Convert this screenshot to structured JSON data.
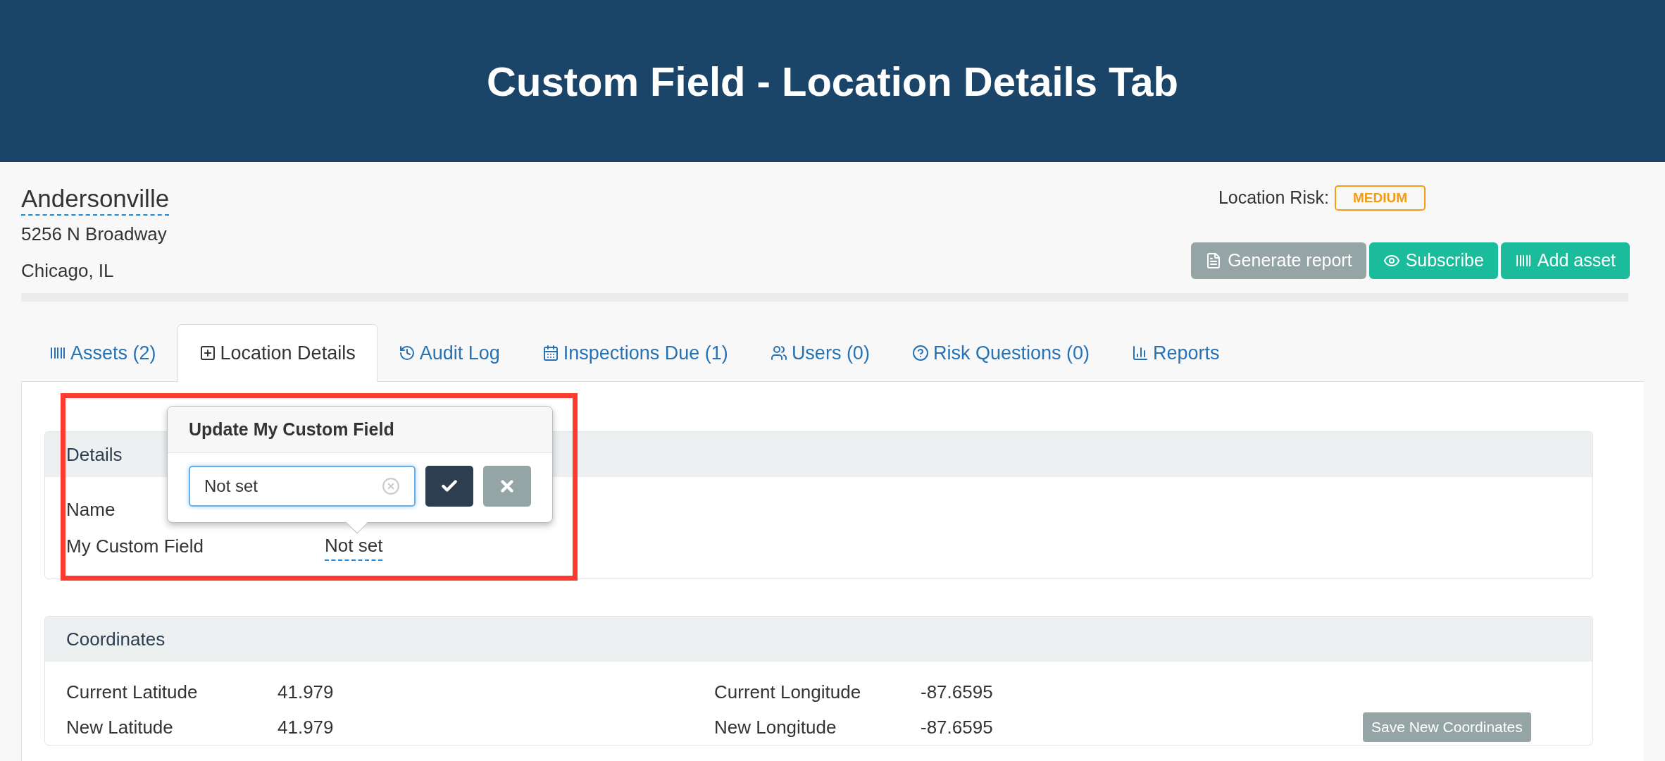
{
  "header": {
    "title": "Custom Field - Location Details Tab"
  },
  "location": {
    "name": "Andersonville",
    "address_lines": [
      "5256 N Broadway",
      "Chicago, IL"
    ],
    "risk_label": "Location Risk:",
    "risk": "MEDIUM"
  },
  "actions": [
    {
      "label": "Generate report",
      "kind": "report"
    },
    {
      "label": "Subscribe",
      "kind": "subscribe"
    },
    {
      "label": "Add asset",
      "kind": "asset"
    }
  ],
  "tabs": [
    {
      "label": "Assets (2)",
      "selected": false
    },
    {
      "label": "Location Details",
      "selected": true
    },
    {
      "label": "Audit Log",
      "selected": false
    },
    {
      "label": "Inspections Due (1)",
      "selected": false
    },
    {
      "label": "Users (0)",
      "selected": false
    },
    {
      "label": "Risk Questions (0)",
      "selected": false
    },
    {
      "label": "Reports",
      "selected": false
    }
  ],
  "details": {
    "title": "Details",
    "rows": [
      {
        "label": "Name"
      },
      {
        "label": "My Custom Field",
        "value": "Not set"
      }
    ]
  },
  "popover": {
    "title": "Update My Custom Field",
    "value": "Not set"
  },
  "coordinates": {
    "title": "Coordinates",
    "rows": [
      {
        "label": "Current Latitude",
        "value": "41.979",
        "label2": "Current Longitude",
        "value2": "-87.6595"
      },
      {
        "label": "New Latitude",
        "value": "41.979",
        "label2": "New Longitude",
        "value2": "-87.6595"
      }
    ],
    "save_button": "Save New Coordinates"
  }
}
